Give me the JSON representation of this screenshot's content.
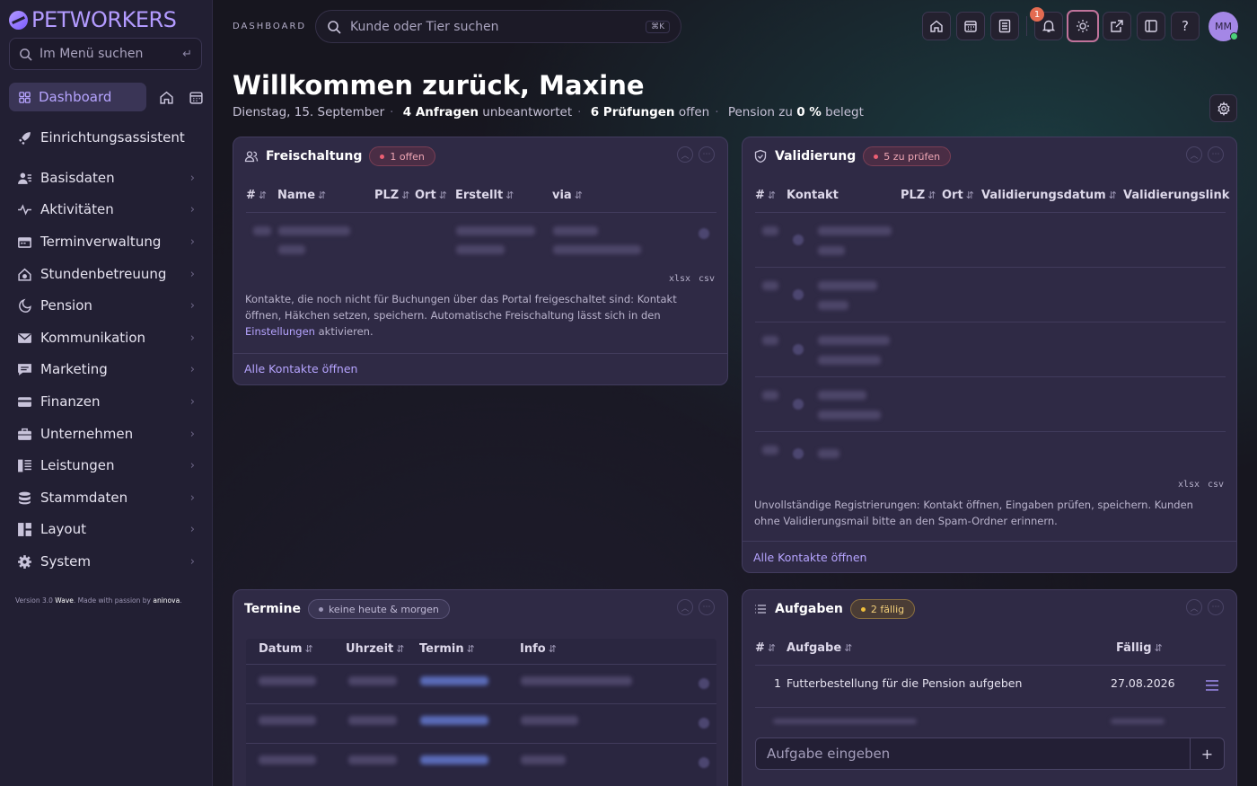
{
  "brand": {
    "name": "PETWORKERS"
  },
  "sidebar": {
    "search_placeholder": "Im Menü suchen",
    "dashboard_label": "Dashboard",
    "wizard_label": "Einrichtungsassistent",
    "items": [
      {
        "label": "Basisdaten",
        "icon": "users-icon"
      },
      {
        "label": "Aktivitäten",
        "icon": "activity-icon"
      },
      {
        "label": "Terminverwaltung",
        "icon": "calendar-icon"
      },
      {
        "label": "Stundenbetreuung",
        "icon": "home-pet-icon"
      },
      {
        "label": "Pension",
        "icon": "moon-icon"
      },
      {
        "label": "Kommunikation",
        "icon": "mail-icon"
      },
      {
        "label": "Marketing",
        "icon": "chat-icon"
      },
      {
        "label": "Finanzen",
        "icon": "card-icon"
      },
      {
        "label": "Unternehmen",
        "icon": "briefcase-icon"
      },
      {
        "label": "Leistungen",
        "icon": "list-icon"
      },
      {
        "label": "Stammdaten",
        "icon": "database-icon"
      },
      {
        "label": "Layout",
        "icon": "layout-icon"
      },
      {
        "label": "System",
        "icon": "gear-icon"
      }
    ],
    "version_prefix": "Version 3.0",
    "version_name": "Wave",
    "version_mid": ". Made with passion by",
    "version_brand": "aninova",
    "version_end": "."
  },
  "topbar": {
    "breadcrumb": "DASHBOARD",
    "search_placeholder": "Kunde oder Tier suchen",
    "search_kbd": "⌘K",
    "notification_count": "1",
    "avatar_initials": "MM"
  },
  "welcome": {
    "title": "Willkommen zurück, Maxine",
    "date": "Dienstag, 15. September",
    "requests_bold": "4 Anfragen",
    "requests_rest": "unbeantwortet",
    "checks_bold": "6 Prüfungen",
    "checks_rest": "offen",
    "pension_pre": "Pension zu",
    "pension_bold": "0 %",
    "pension_rest": "belegt"
  },
  "freischaltung": {
    "title": "Freischaltung",
    "badge": "1 offen",
    "columns": [
      "#",
      "Name",
      "PLZ",
      "Ort",
      "Erstellt",
      "via"
    ],
    "export_xlsx": "xlsx",
    "export_csv": "csv",
    "note_pre": "Kontakte, die noch nicht für Buchungen über das Portal freigeschaltet sind: Kontakt öffnen, Häkchen setzen, speichern. Automatische Freischaltung lässt sich in den",
    "note_link": "Einstellungen",
    "note_post": "aktivieren.",
    "footer_link": "Alle Kontakte öffnen"
  },
  "validierung": {
    "title": "Validierung",
    "badge": "5 zu prüfen",
    "columns": [
      "#",
      "Kontakt",
      "PLZ",
      "Ort",
      "Validierungsdatum",
      "Validierungslink"
    ],
    "export_xlsx": "xlsx",
    "export_csv": "csv",
    "note": "Unvollständige Registrierungen: Kontakt öffnen, Eingaben prüfen, speichern. Kunden ohne Validierungsmail bitte an den Spam-Ordner erinnern.",
    "footer_link": "Alle Kontakte öffnen"
  },
  "termine": {
    "title": "Termine",
    "badge": "keine heute & morgen",
    "columns": [
      "Datum",
      "Uhrzeit",
      "Termin",
      "Info"
    ]
  },
  "aufgaben": {
    "title": "Aufgaben",
    "badge": "2 fällig",
    "columns": [
      "#",
      "Aufgabe",
      "Fällig"
    ],
    "rows": [
      {
        "num": "1",
        "task": "Futterbestellung für die Pension aufgeben",
        "due": "27.08.2026"
      }
    ],
    "input_placeholder": "Aufgabe eingeben",
    "add_label": "+"
  },
  "colors": {
    "accent": "#b6a4ff",
    "danger": "#ec5f73",
    "warning": "#efbf3c",
    "sidebar_bg": "#221f33",
    "card_bg": "#2f2a45"
  }
}
